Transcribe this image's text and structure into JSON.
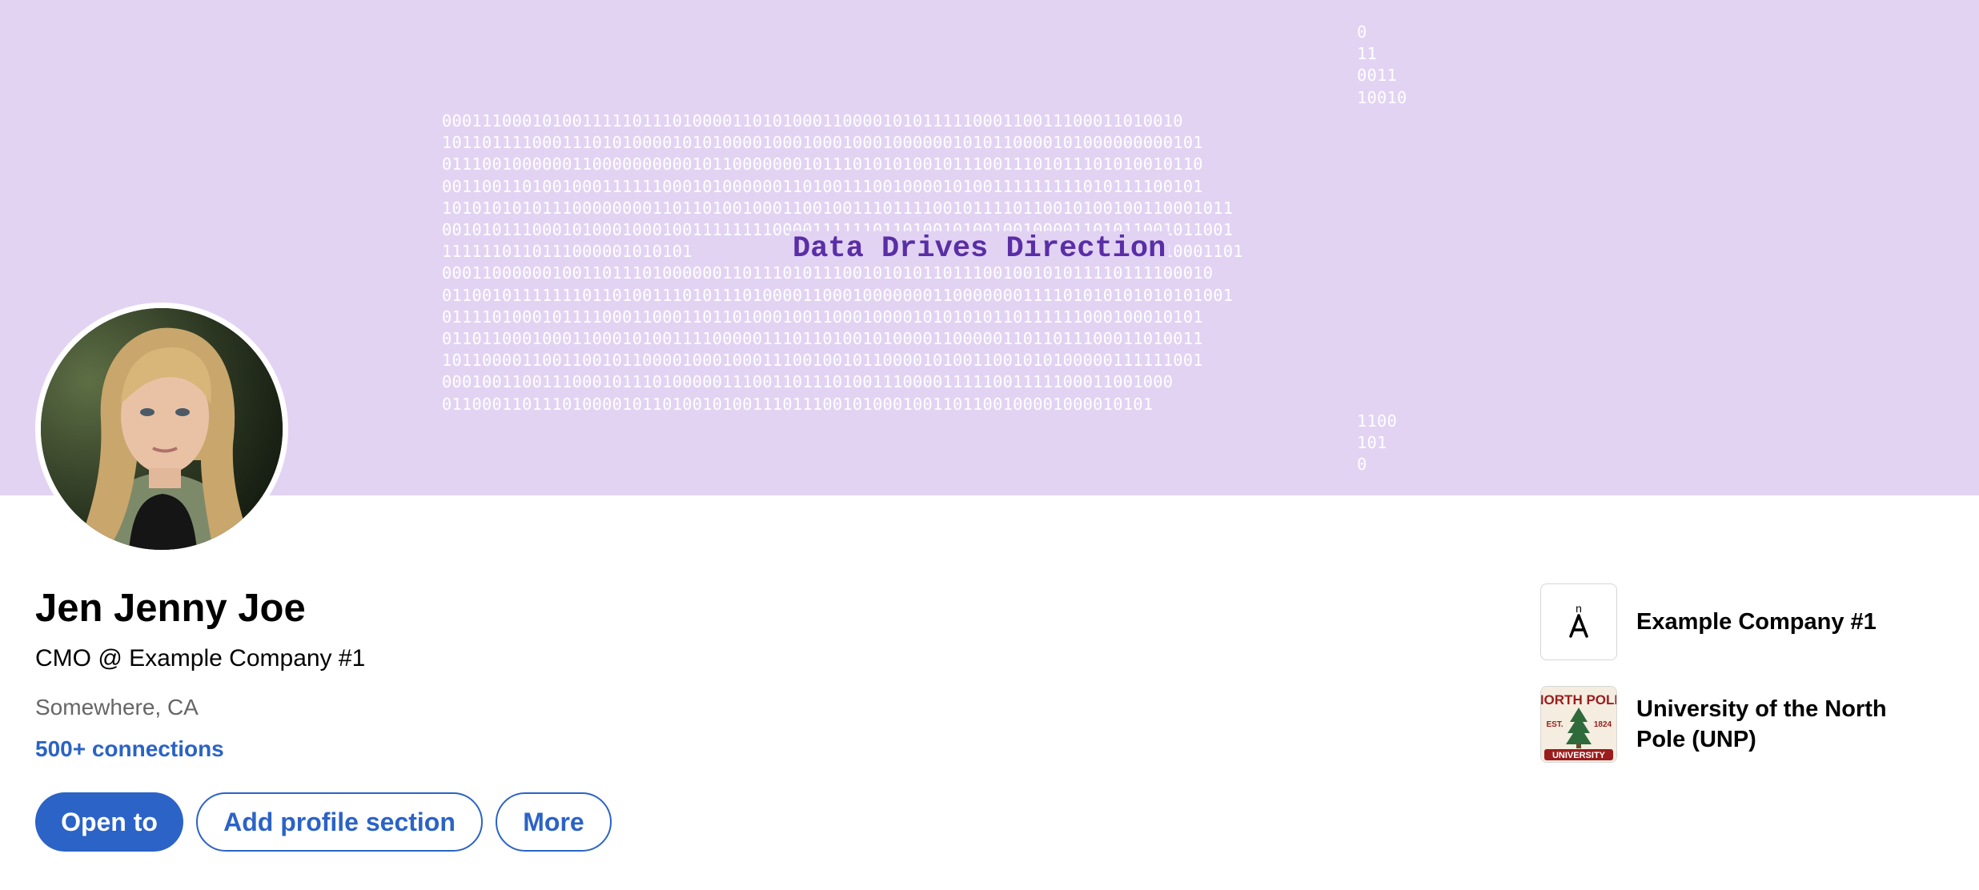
{
  "banner": {
    "tagline": "Data Drives Direction",
    "binary_top": "0\n11\n0011\n10010",
    "binary_main": "00011100010100111110111010000110101000110000101011111000110011100011010010\n1011011110001110101000010101000010001000100010000001010110000101000000000101\n0111001000000110000000000101100000001011101010100101110011101011101010010110\n0011001101001000111111000101000000110100111001000010100111111111010111100101\n1010101010111000000001101101001000110010011101111001011110110010100100110001011\n0010101110001010001000100111111110000111111011010010100100100001101011001011001\n1111110110111000001010101                             10101100101001110110001101\n00011000000100110111010000001101110101110010101011011100100101011110111100010\n0110010111111101101001110101110100001100010000000110000000111101010101010101001\n0111101000101111000110001101101000100110001000010101010110111111000100010101\n0110110001000110001010011110000011101101001010000110000011011011100011010011\n1011000011001100101100001000100011100100101100001010011001010100000111111001\n0001001100111000101110100000111001101110100111000011111001111100011001000\n01100011011101000010110100101001110111001010001001101100100001000010101",
    "binary_bottom": "1100\n101\n0"
  },
  "profile": {
    "name": "Jen Jenny Joe",
    "headline": "CMO @ Example Company #1",
    "location": "Somewhere, CA",
    "connections": "500+ connections"
  },
  "actions": {
    "open_to": "Open to",
    "add_section": "Add profile section",
    "more": "More"
  },
  "organizations": [
    {
      "name": "Example Company #1",
      "logo": "example-company-logo"
    },
    {
      "name": "University of the North Pole (UNP)",
      "logo": "north-pole-university-logo"
    }
  ],
  "logos": {
    "company_mark": "n",
    "university_top": "NORTH POLE",
    "university_est": "EST.",
    "university_year": "1824",
    "university_bottom": "UNIVERSITY"
  },
  "colors": {
    "banner": "#e2d3f3",
    "tagline": "#5a2ea6",
    "accent": "#2b63c6",
    "muted_text": "#666666",
    "university_red": "#9b1c1c",
    "university_green": "#2f6b3a"
  }
}
